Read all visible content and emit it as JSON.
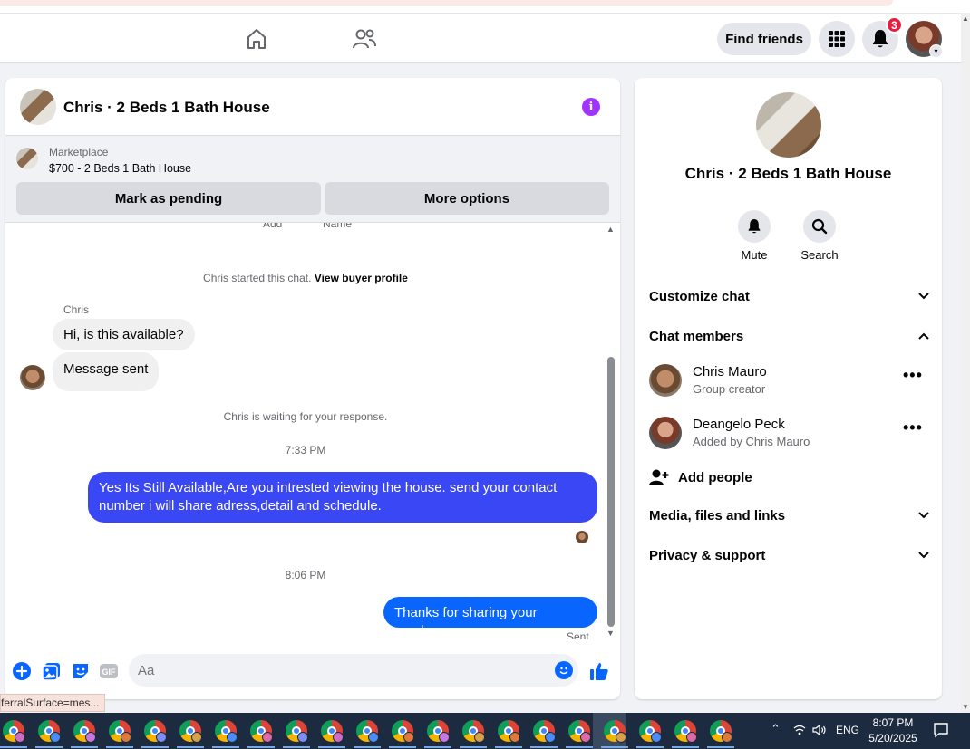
{
  "topnav": {
    "home_icon": "home-icon",
    "friends_icon": "friends-icon",
    "find_friends_label": "Find friends",
    "menu_icon": "grid-menu-icon",
    "notifications_icon": "bell-icon",
    "notification_count": "3",
    "account_icon": "avatar"
  },
  "chat": {
    "title": "Chris · 2 Beds 1 Bath House",
    "marketplace": {
      "label": "Marketplace",
      "item": "$700 - 2 Beds 1 Bath House",
      "mark_pending_label": "Mark as pending",
      "more_options_label": "More options"
    },
    "cut_off": [
      "Add",
      "Name"
    ],
    "started_text": "Chris started this chat.",
    "view_profile_link": "View buyer profile",
    "sender_name": "Chris",
    "incoming": [
      "Hi, is this available?",
      "Message sent"
    ],
    "waiting_text": "Chris is waiting for your response.",
    "time1": "7:33 PM",
    "outgoing1": "Yes Its Still Available,Are you intrested viewing the house. send your contact number i will share adress,detail and schedule.",
    "time2": "8:06 PM",
    "outgoing2": "Thanks for sharing your number",
    "sent_label": "Sent",
    "composer_placeholder": "Aa",
    "accent_color": "#3a47f5"
  },
  "url_tooltip": "ferralSurface=mes...",
  "info_panel": {
    "title": "Chris · 2 Beds 1 Bath House",
    "mute_label": "Mute",
    "search_label": "Search",
    "customize_chat": "Customize chat",
    "chat_members": "Chat members",
    "members": [
      {
        "name": "Chris Mauro",
        "sub": "Group creator"
      },
      {
        "name": "Deangelo Peck",
        "sub": "Added by Chris Mauro"
      }
    ],
    "add_people": "Add people",
    "media": "Media, files and links",
    "privacy": "Privacy & support"
  },
  "taskbar": {
    "language": "ENG",
    "time": "8:07 PM",
    "date": "5/20/2025"
  }
}
